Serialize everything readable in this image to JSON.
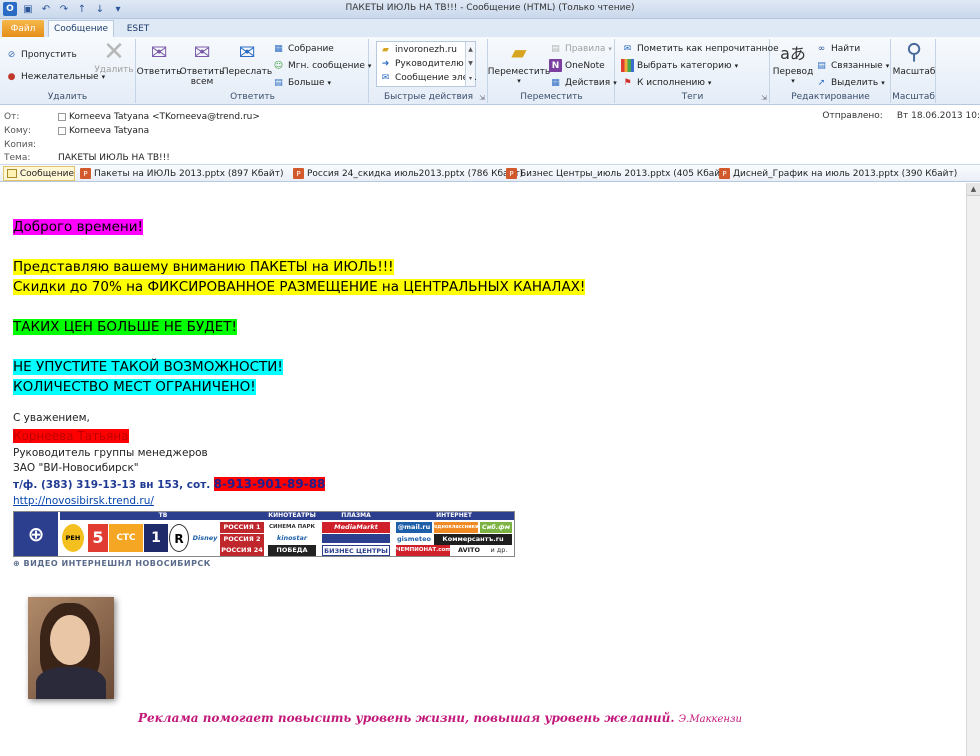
{
  "window": {
    "title": "ПАКЕТЫ ИЮЛЬ НА ТВ!!! - Сообщение (HTML) (Только чтение)"
  },
  "tabs": {
    "file": "Файл",
    "message": "Сообщение",
    "eset": "ESET"
  },
  "ribbon": {
    "delete": {
      "label": "Удалить",
      "ignore": "Пропустить",
      "junk": "Нежелательные",
      "delete_btn": "Удалить"
    },
    "respond": {
      "label": "Ответить",
      "reply": "Ответить",
      "reply_all_1": "Ответить",
      "reply_all_2": "всем",
      "forward": "Переслать",
      "meeting": "Собрание",
      "im": "Мгн. сообщение",
      "more": "Больше"
    },
    "quick": {
      "label": "Быстрые действия",
      "item1": "invoronezh.ru",
      "item2": "Руководителю",
      "item3": "Сообщение эле..."
    },
    "move": {
      "label": "Переместить",
      "move_btn": "Переместить",
      "rules": "Правила",
      "onenote": "OneNote",
      "actions": "Действия"
    },
    "tags": {
      "label": "Теги",
      "unread": "Пометить как непрочитанное",
      "categorize": "Выбрать категорию",
      "followup": "К исполнению"
    },
    "editing": {
      "label": "Редактирование",
      "translate": "Перевод",
      "find": "Найти",
      "related": "Связанные",
      "select": "Выделить"
    },
    "zoom": {
      "label": "Масштаб",
      "zoom_btn": "Масштаб"
    }
  },
  "header": {
    "from_label": "От:",
    "from_value": "Korneeva Tatyana <TKorneeva@trend.ru>",
    "to_label": "Кому:",
    "to_value": "Korneeva Tatyana",
    "cc_label": "Копия:",
    "subject_label": "Тема:",
    "subject_value": "ПАКЕТЫ ИЮЛЬ НА ТВ!!!",
    "sent_label": "Отправлено:",
    "sent_value": "Вт 18.06.2013 10:"
  },
  "attachments": {
    "message": "Сообщение",
    "files": [
      "Пакеты на ИЮЛЬ 2013.pptx (897 Кбайт)",
      "Россия 24_скидка июль2013.pptx (786 Кбайт)",
      "Бизнес Центры_июль 2013.pptx (405 Кбайт)",
      "Дисней_График на июль 2013.pptx (390 Кбайт)"
    ]
  },
  "body": {
    "greeting": "Доброго времени!",
    "line1": "Представляю вашему вниманию ПАКЕТЫ на ИЮЛЬ!!!",
    "line2": "Скидки до 70% на ФИКСИРОВАННОЕ РАЗМЕЩЕНИЕ на ЦЕНТРАЛЬНЫХ КАНАЛАХ!",
    "line3": "ТАКИХ ЦЕН БОЛЬШЕ НЕ БУДЕТ!",
    "line4": "НЕ УПУСТИТЕ ТАКОЙ ВОЗМОЖНОСТИ!",
    "line5": "КОЛИЧЕСТВО МЕСТ ОГРАНИЧЕНО!",
    "regards": "С уважением,",
    "name": "Корнеева Татьяна",
    "position": "Руководитель группы менеджеров",
    "company": "ЗАО \"ВИ-Новосибирск\"",
    "phone": "т/ф. (383) 319-13-13 вн 153, сот.",
    "mobile": "8-913-901-89-88",
    "link": "http://novosibirsk.trend.ru/",
    "banner_caption": "ВИДЕО ИНТЕРНЕШНЛ НОВОСИБИРСК",
    "quote": "Реклама помогает повысить уровень жизни, повышая уровень желаний.",
    "quote_author": "Э.Маккензи"
  },
  "banner": {
    "sections": {
      "tv": "ТВ",
      "cinema": "КИНОТЕАТРЫ",
      "plasma": "ПЛАЗМА",
      "internet": "ИНТЕРНЕТ"
    },
    "channels": [
      "РЕН",
      "5",
      "СТС",
      "1",
      "R",
      "Disney"
    ],
    "russia": [
      "РОССИЯ 1",
      "РОССИЯ 2",
      "РОССИЯ 24"
    ],
    "cinemas": [
      "СИНЕМА ПАРК",
      "kinostar",
      "ПОБЕДА"
    ],
    "plasma": [
      "MediaMarkt",
      "БИЗНЕС ЦЕНТРЫ"
    ],
    "internet": [
      "@mail.ru",
      "одноклассники",
      "Сиб.фм",
      "gismeteo",
      "Коммерсантъ.ru",
      "ЧЕМПИОНАТ.com",
      "AVITO",
      "и др."
    ]
  }
}
